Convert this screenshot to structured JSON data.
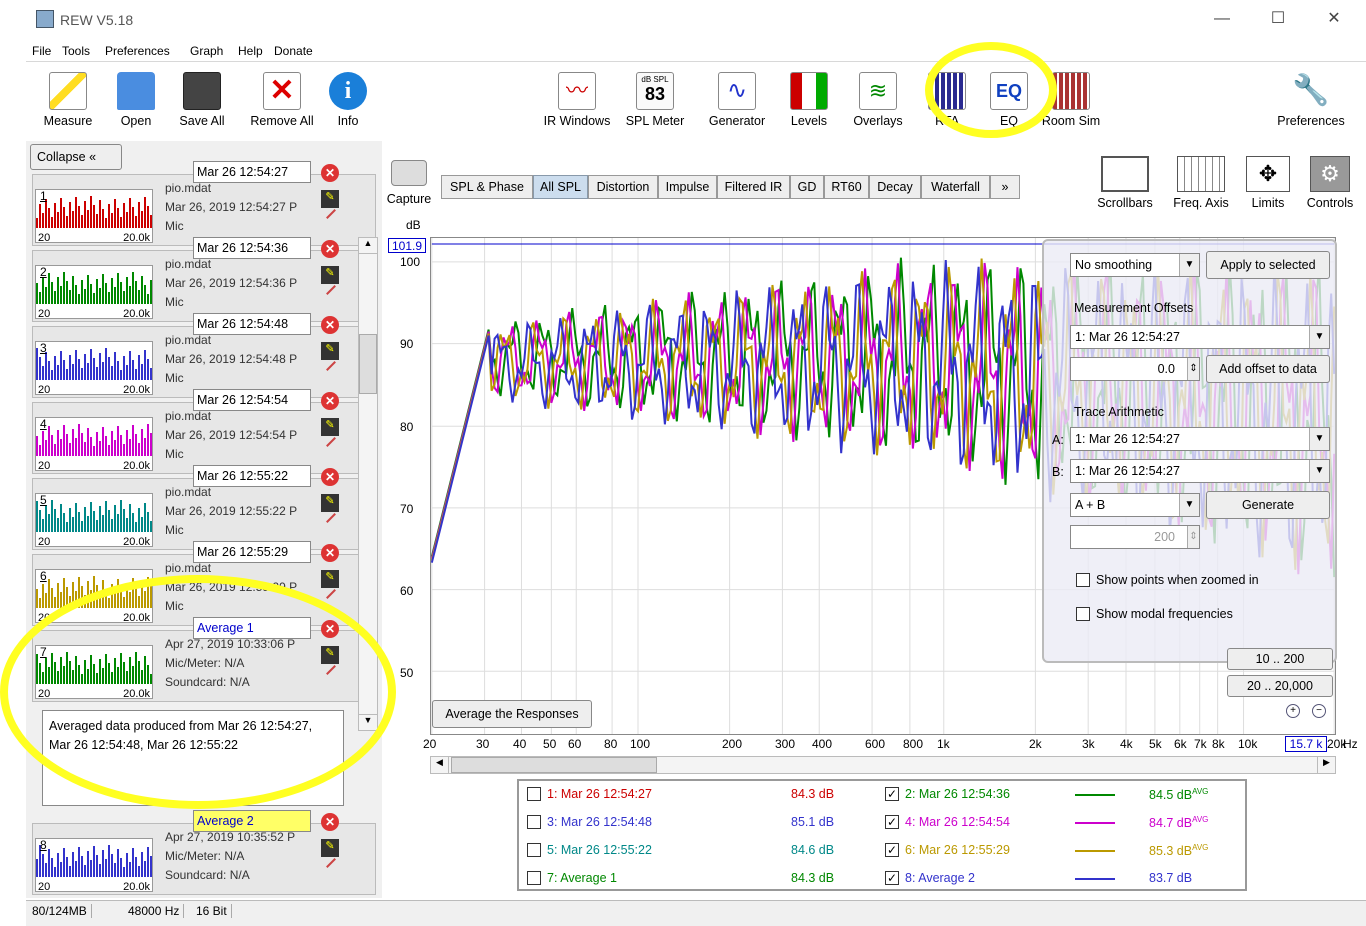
{
  "window": {
    "title": "REW V5.18",
    "controls": [
      "—",
      "☐",
      "✕"
    ]
  },
  "menu": [
    "File",
    "Tools",
    "Preferences",
    "Graph",
    "Help",
    "Donate"
  ],
  "toolbar_left": [
    {
      "label": "Measure",
      "icon": "measure-icon"
    },
    {
      "label": "Open",
      "icon": "folder-icon"
    },
    {
      "label": "Save All",
      "icon": "save-icon"
    },
    {
      "label": "Remove All",
      "icon": "remove-icon"
    },
    {
      "label": "Info",
      "icon": "info-icon"
    }
  ],
  "toolbar_center": [
    {
      "label": "IR Windows",
      "icon": "ir-windows-icon"
    },
    {
      "label": "SPL Meter",
      "icon": "spl-meter-icon",
      "value": "83",
      "unit": "dB SPL"
    },
    {
      "label": "Generator",
      "icon": "generator-icon"
    },
    {
      "label": "Levels",
      "icon": "levels-icon"
    },
    {
      "label": "Overlays",
      "icon": "overlays-icon"
    },
    {
      "label": "RTA",
      "icon": "rta-icon"
    },
    {
      "label": "EQ",
      "icon": "eq-icon"
    },
    {
      "label": "Room Sim",
      "icon": "room-sim-icon"
    }
  ],
  "toolbar_right": {
    "label": "Preferences",
    "icon": "wrench-icon"
  },
  "left_panel": {
    "collapse_label": "Collapse",
    "measurements": [
      {
        "num": "1",
        "name": "Mar 26 12:54:27",
        "file": "pio.mdat",
        "date": "Mar 26, 2019 12:54:27 P",
        "extra": "Mic",
        "color": "#cc0000"
      },
      {
        "num": "2",
        "name": "Mar 26 12:54:36",
        "file": "pio.mdat",
        "date": "Mar 26, 2019 12:54:36 P",
        "extra": "Mic",
        "color": "#008800"
      },
      {
        "num": "3",
        "name": "Mar 26 12:54:48",
        "file": "pio.mdat",
        "date": "Mar 26, 2019 12:54:48 P",
        "extra": "Mic",
        "color": "#3333cc"
      },
      {
        "num": "4",
        "name": "Mar 26 12:54:54",
        "file": "pio.mdat",
        "date": "Mar 26, 2019 12:54:54 P",
        "extra": "Mic",
        "color": "#cc00cc"
      },
      {
        "num": "5",
        "name": "Mar 26 12:55:22",
        "file": "pio.mdat",
        "date": "Mar 26, 2019 12:55:22 P",
        "extra": "Mic",
        "color": "#008888"
      },
      {
        "num": "6",
        "name": "Mar 26 12:55:29",
        "file": "pio.mdat",
        "date": "Mar 26, 2019 12:55:29 P",
        "extra": "Mic",
        "color": "#bb9900"
      },
      {
        "num": "7",
        "name": "Average 1",
        "file": "Apr 27, 2019 10:33:06 P",
        "date": "Mic/Meter: N/A",
        "extra": "Soundcard: N/A",
        "color": "#008800"
      },
      {
        "num": "8",
        "name": "Average 2",
        "file": "Apr 27, 2019 10:35:52 P",
        "date": "Mic/Meter: N/A",
        "extra": "Soundcard: N/A",
        "color": "#3333cc"
      }
    ],
    "thumb_20": "20",
    "thumb_20k": "20.0k",
    "notes": "Averaged data produced from Mar 26 12:54:27, Mar 26 12:54:48, Mar 26 12:55:22"
  },
  "graph": {
    "capture_label": "Capture",
    "tabs": [
      "SPL & Phase",
      "All SPL",
      "Distortion",
      "Impulse",
      "Filtered IR",
      "GD",
      "RT60",
      "Decay",
      "Waterfall",
      "»"
    ],
    "active_tab": "All SPL",
    "right_buttons": [
      "Scrollbars",
      "Freq. Axis",
      "Limits",
      "Controls"
    ],
    "y_unit": "dB",
    "y_cursor": "101.9",
    "y_ticks": [
      "100",
      "90",
      "80",
      "70",
      "60",
      "50"
    ],
    "x_ticks": [
      "20",
      "30",
      "40",
      "50",
      "60",
      "80",
      "100",
      "200",
      "300",
      "400",
      "600",
      "800",
      "1k",
      "2k",
      "3k",
      "4k",
      "5k",
      "6k",
      "7k",
      "8k",
      "10k",
      "20k",
      "Hz"
    ],
    "x_cursor": "15.7 k",
    "average_button": "Average the Responses"
  },
  "controls_panel": {
    "smoothing": "No  smoothing",
    "apply_button": "Apply to selected",
    "offsets_title": "Measurement Offsets",
    "offset_meas": "1: Mar 26 12:54:27",
    "offset_value": "0.0",
    "add_offset_button": "Add offset to data",
    "trace_title": "Trace Arithmetic",
    "a_label": "A:",
    "a_value": "1: Mar 26 12:54:27",
    "b_label": "B:",
    "b_value": "1: Mar 26 12:54:27",
    "op_value": "A + B",
    "generate_button": "Generate",
    "field_200": "200",
    "show_points": "Show points when zoomed in",
    "show_modal": "Show modal frequencies",
    "range1": "10 .. 200",
    "range2": "20 .. 20,000"
  },
  "legend": [
    {
      "label": "1: Mar 26 12:54:27",
      "value": "84.3 dB",
      "checked": false,
      "color": "#cc0000"
    },
    {
      "label": "2: Mar 26 12:54:36",
      "value": "84.5 dB",
      "sup": "AVG",
      "checked": true,
      "color": "#008800"
    },
    {
      "label": "3: Mar 26 12:54:48",
      "value": "85.1 dB",
      "checked": false,
      "color": "#3333cc"
    },
    {
      "label": "4: Mar 26 12:54:54",
      "value": "84.7 dB",
      "sup": "AVG",
      "checked": true,
      "color": "#cc00cc"
    },
    {
      "label": "5: Mar 26 12:55:22",
      "value": "84.6 dB",
      "checked": false,
      "color": "#008888"
    },
    {
      "label": "6: Mar 26 12:55:29",
      "value": "85.3 dB",
      "sup": "AVG",
      "checked": true,
      "color": "#bb9900"
    },
    {
      "label": "7: Average 1",
      "value": "84.3 dB",
      "checked": false,
      "color": "#008800"
    },
    {
      "label": "8: Average 2",
      "value": "83.7 dB",
      "checked": true,
      "color": "#3333cc"
    }
  ],
  "status": [
    "80/124MB",
    "48000 Hz",
    "16 Bit"
  ],
  "colors": {
    "highlight": "#ffff22",
    "accent": "#0000cc"
  }
}
